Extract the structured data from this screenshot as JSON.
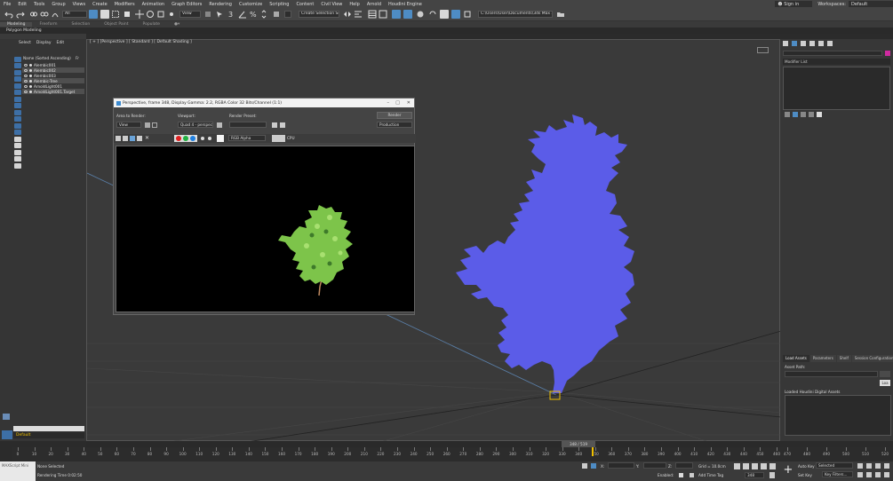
{
  "menu": [
    "File",
    "Edit",
    "Tools",
    "Group",
    "Views",
    "Create",
    "Modifiers",
    "Animation",
    "Graph Editors",
    "Rendering",
    "Customize",
    "Scripting",
    "Content",
    "Civil View",
    "Help",
    "Arnold",
    "Houdini Engine"
  ],
  "menu_right": {
    "signin": "Sign in",
    "workspaces_label": "Workspaces:",
    "workspace": "Default"
  },
  "toolbar": {
    "filter": "All",
    "view": "View",
    "selection_set": "Create Selection Se",
    "path": "C:\\Users\\User\\Documents\\3ds Max 2022"
  },
  "ribbon": {
    "tabs": [
      "Modeling",
      "Freeform",
      "Selection",
      "Object Paint",
      "Populate"
    ],
    "active": "Modeling"
  },
  "polybar": "Polygon Modeling",
  "scene_explorer": {
    "tabs": [
      "Select",
      "Display",
      "Edit"
    ],
    "header": "Name (Sorted Ascending)",
    "header_right": "Fr",
    "rows": [
      "Alembic001",
      "Alembic002",
      "Alembic003",
      "Alembic-Tree",
      "ArnoldLight001",
      "ArnoldLight001.Target"
    ],
    "selected_rows": [
      1,
      3,
      5
    ],
    "layer": "Default"
  },
  "viewport": {
    "label": "[ + ] [Perspective ] [ Standard ] [ Default Shading ]"
  },
  "render_window": {
    "title": "Perspective, frame 348, Display Gamma: 2.2, RGBA Color 32 Bits/Channel (1:1)",
    "area_label": "Area to Render:",
    "area_value": "View",
    "viewport_label": "Viewport:",
    "viewport_value": "Quad 4 - perspec",
    "preset_label": "Render Preset:",
    "preset_value": "",
    "render_button": "Render",
    "production": "Production",
    "channel": "RGB Alpha",
    "cpu": "CPU"
  },
  "command_panel": {
    "modifier_list": "Modifier List",
    "tabs": [
      "Load Assets",
      "Parameters",
      "Shelf",
      "Session Configuration"
    ],
    "active_tab": "Load Assets",
    "asset_path_label": "Asset Path:",
    "load_button": "Loa",
    "loaded_label": "Loaded Houdini Digital Assets"
  },
  "timeline": {
    "current": "348 / 519",
    "ticks": [
      0,
      10,
      20,
      30,
      40,
      50,
      60,
      70,
      80,
      90,
      100,
      110,
      120,
      130,
      140,
      150,
      160,
      170,
      180,
      190,
      200,
      210,
      220,
      230,
      240,
      250,
      260,
      270,
      280,
      290,
      300,
      310,
      320,
      330,
      340,
      350,
      360,
      370,
      380,
      390,
      400,
      410,
      420,
      430,
      440,
      450,
      460
    ],
    "ticks_right": [
      470,
      480,
      490,
      500,
      510,
      520
    ]
  },
  "status": {
    "script": "MAXScript Mini",
    "selection": "None Selected",
    "render_time": "Rendering Time 0:02:50",
    "x_label": "X:",
    "y_label": "Y:",
    "z_label": "Z:",
    "grid": "Grid = 10.0cm",
    "enabled": "Enabled:",
    "add_time_tag": "Add Time Tag",
    "frame": "348",
    "auto_key": "Auto Key",
    "selected": "Selected",
    "set_key": "Set Key",
    "key_filters": "Key Filters..."
  },
  "colors": {
    "tree_silhouette": "#5b5ce8",
    "tree_render": "#7dc44a",
    "accent": "#4e8cc4",
    "object_color": "#d02aa0",
    "layer_text": "#f0c000"
  }
}
